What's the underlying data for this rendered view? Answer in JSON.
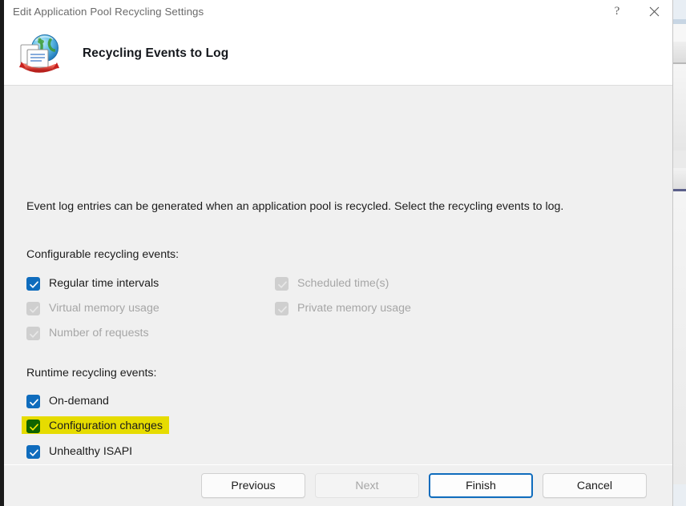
{
  "window": {
    "title": "Edit Application Pool Recycling Settings",
    "help_label": "?",
    "close_label": "✕",
    "help_icon": "question-mark-icon",
    "close_icon": "close-icon"
  },
  "header": {
    "title": "Recycling Events to Log",
    "icon": "recycling-globe-document-icon"
  },
  "body": {
    "intro": "Event log entries can be generated when an application pool is recycled. Select the recycling events to log.",
    "configurable_group_label": "Configurable recycling events:",
    "runtime_group_label": "Runtime recycling events:",
    "configurable_events": [
      {
        "label": "Regular time intervals",
        "checked": true,
        "enabled": true,
        "highlighted": false
      },
      {
        "label": "Scheduled time(s)",
        "checked": true,
        "enabled": false,
        "highlighted": false
      },
      {
        "label": "Virtual memory usage",
        "checked": true,
        "enabled": false,
        "highlighted": false
      },
      {
        "label": "Private memory usage",
        "checked": true,
        "enabled": false,
        "highlighted": false
      },
      {
        "label": "Number of requests",
        "checked": true,
        "enabled": false,
        "highlighted": false
      }
    ],
    "runtime_events": [
      {
        "label": "On-demand",
        "checked": true,
        "enabled": true,
        "highlighted": false
      },
      {
        "label": "Configuration changes",
        "checked": true,
        "enabled": true,
        "highlighted": true
      },
      {
        "label": "Unhealthy ISAPI",
        "checked": true,
        "enabled": true,
        "highlighted": false
      }
    ]
  },
  "footer": {
    "buttons": [
      {
        "label": "Previous",
        "state": "enabled"
      },
      {
        "label": "Next",
        "state": "disabled"
      },
      {
        "label": "Finish",
        "state": "default"
      },
      {
        "label": "Cancel",
        "state": "enabled"
      }
    ]
  },
  "colors": {
    "accent": "#0f6cbd",
    "highlight": "#f5ea00",
    "dialog_bg": "#f0f0f0",
    "header_bg": "#ffffff",
    "disabled_text": "#a6a6a6"
  }
}
